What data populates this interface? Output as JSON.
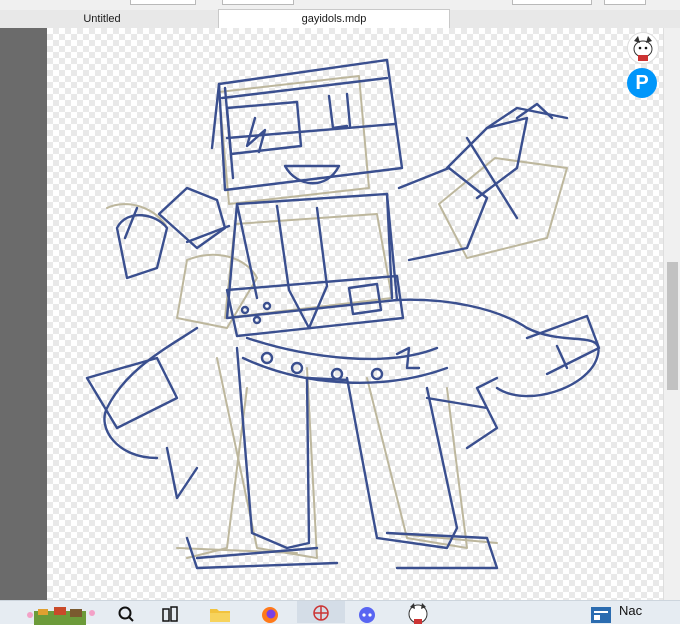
{
  "tabs": [
    {
      "label": "Untitled",
      "active": false
    },
    {
      "label": "gayidols.mdp",
      "active": true
    }
  ],
  "badges": {
    "avatar_icon": "dog-avatar-icon",
    "pixiv_letter": "P",
    "pixiv_color": "#0096fa"
  },
  "taskbar": {
    "items": [
      "widget-icon",
      "search-icon",
      "task-view-icon",
      "file-explorer-icon",
      "firefox-icon",
      "art-app-icon",
      "discord-icon",
      "avatar-app-icon",
      "news-icon"
    ],
    "label": "Nac"
  },
  "colors": {
    "line_blue": "#3a4f8f",
    "line_tan": "#bdb79d",
    "sidebar_gray": "#6b6b6b"
  }
}
